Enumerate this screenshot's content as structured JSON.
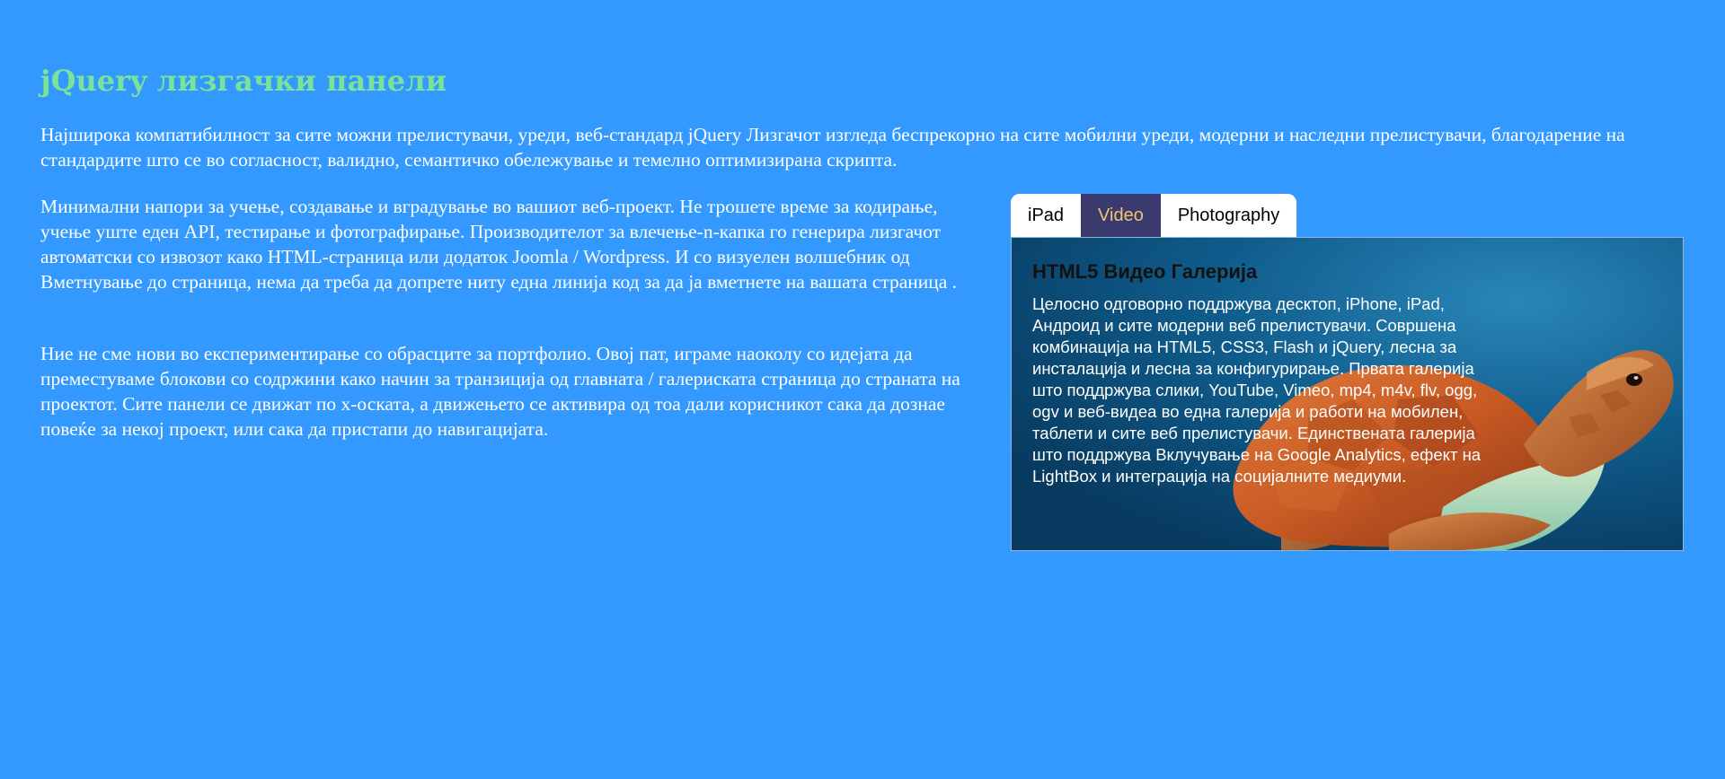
{
  "header": {
    "title": "jQuery лизгачки панели"
  },
  "intro": {
    "text": "Најширока компатибилност за сите можни прелистувачи, уреди, веб-стандард jQuery Лизгачот изгледа беспрекорно на сите мобилни уреди, модерни и наследни прелистувачи, благодарение на стандардите што се во согласност, валидно, семантичко обележување и темелно оптимизирана скрипта."
  },
  "content": {
    "paragraph_1": "Минимални напори за учење, создавање и вградување во вашиот веб-проект. Не трошете време за кодирање, учење уште еден API, тестирање и фотографирање. Производителот за влечење-n-капка го генерира лизгачот автоматски со извозот како HTML-страница или додаток Joomla / Wordpress. И со визуелен волшебник од Вметнување до страница, нема да треба да допрете ниту една линија код за да ја вметнете на вашата страница .",
    "paragraph_2": "Ние не сме нови во експериментирање со обрасците за портфолио. Овој пат, играме наоколу со идејата да преместуваме блокови со содржини како начин за транзиција од главната / галериската страница до страната на проектот. Сите панели се движат по x-оската, а движењето се активира од тоа дали корисникот сака да дознае повеќе за некој проект, или сака да пристапи до навигацијата."
  },
  "tabs": {
    "items": [
      {
        "label": "iPad",
        "active": false
      },
      {
        "label": "Video",
        "active": true
      },
      {
        "label": "Photography",
        "active": false
      }
    ]
  },
  "panel": {
    "title": "HTML5 Видео Галерија",
    "text": "Целосно одговорно поддржува десктоп, iPhone, iPad, Андроид и сите модерни веб прелистувачи. Совршена комбинација на HTML5, CSS3, Flash и jQuery, лесна за инсталација и лесна за конфигурирање. Првата галерија што поддржува слики, YouTube, Vimeo, mp4, m4v, flv, ogg, ogv и веб-видеа во една галерија и работи на мобилен, таблети и сите веб прелистувачи. Единствената галерија што поддржува Вклучување на Google Analytics, ефект на LightBox и интеграција на социјалните медиуми.",
    "image": "sea-turtle-photo"
  },
  "colors": {
    "background": "#3399ff",
    "title": "#7be29a",
    "active_tab_bg": "#3b3a6e",
    "active_tab_text": "#f2c46b"
  }
}
